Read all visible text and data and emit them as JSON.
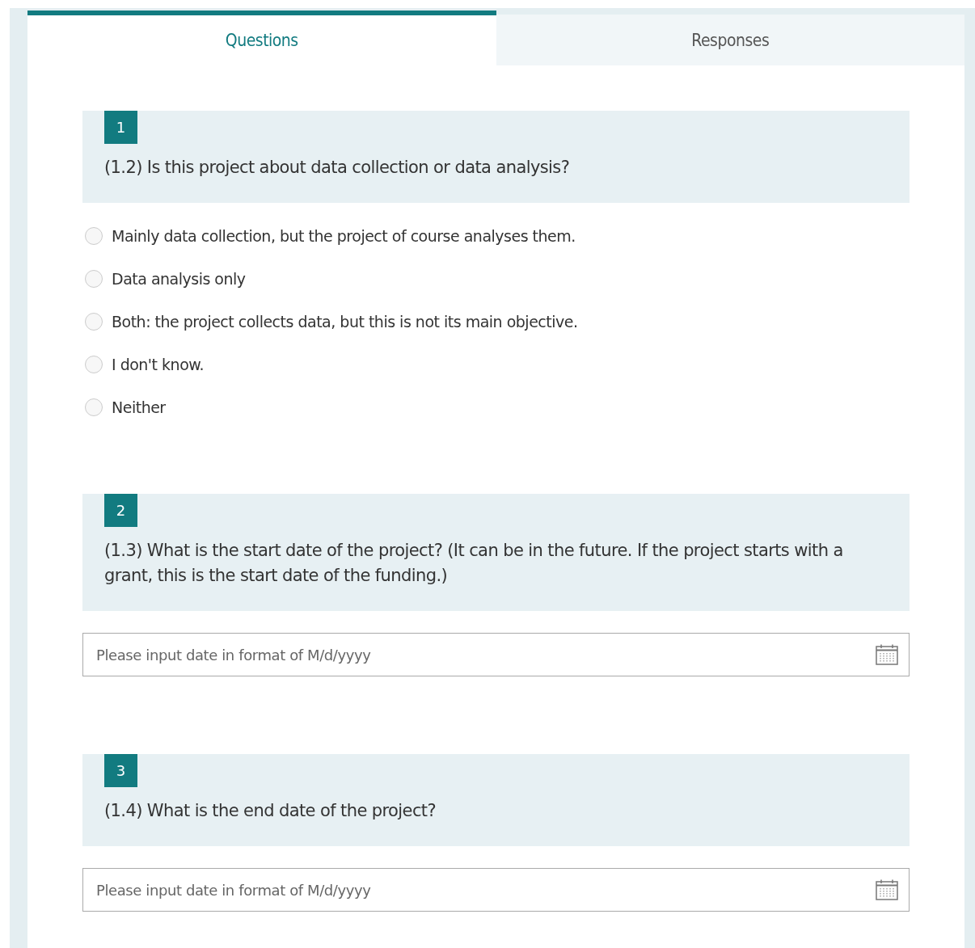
{
  "tabs": [
    {
      "label": "Questions",
      "selected": true
    },
    {
      "label": "Responses",
      "selected": false
    }
  ],
  "questions": [
    {
      "number": "1",
      "title": "(1.2) Is this project about data collection or data analysis?",
      "kind": "choice",
      "options": [
        {
          "label": "Mainly data collection, but the project of course analyses them.",
          "checked": false
        },
        {
          "label": "Data analysis only",
          "checked": false
        },
        {
          "label": "Both: the project collects data, but this is not its main objective.",
          "checked": false
        },
        {
          "label": "I don't know.",
          "checked": false
        },
        {
          "label": "Neither",
          "checked": false
        }
      ]
    },
    {
      "number": "2",
      "title": "(1.3) What is the start date of the project? (It can be in the future. If the project starts with a grant, this is the start date of the funding.)",
      "kind": "date",
      "placeholder": "Please input date in format of M/d/yyyy"
    },
    {
      "number": "3",
      "title": "(1.4) What is the end date of the project?",
      "kind": "date",
      "placeholder": "Please input date in format of M/d/yyyy"
    }
  ]
}
